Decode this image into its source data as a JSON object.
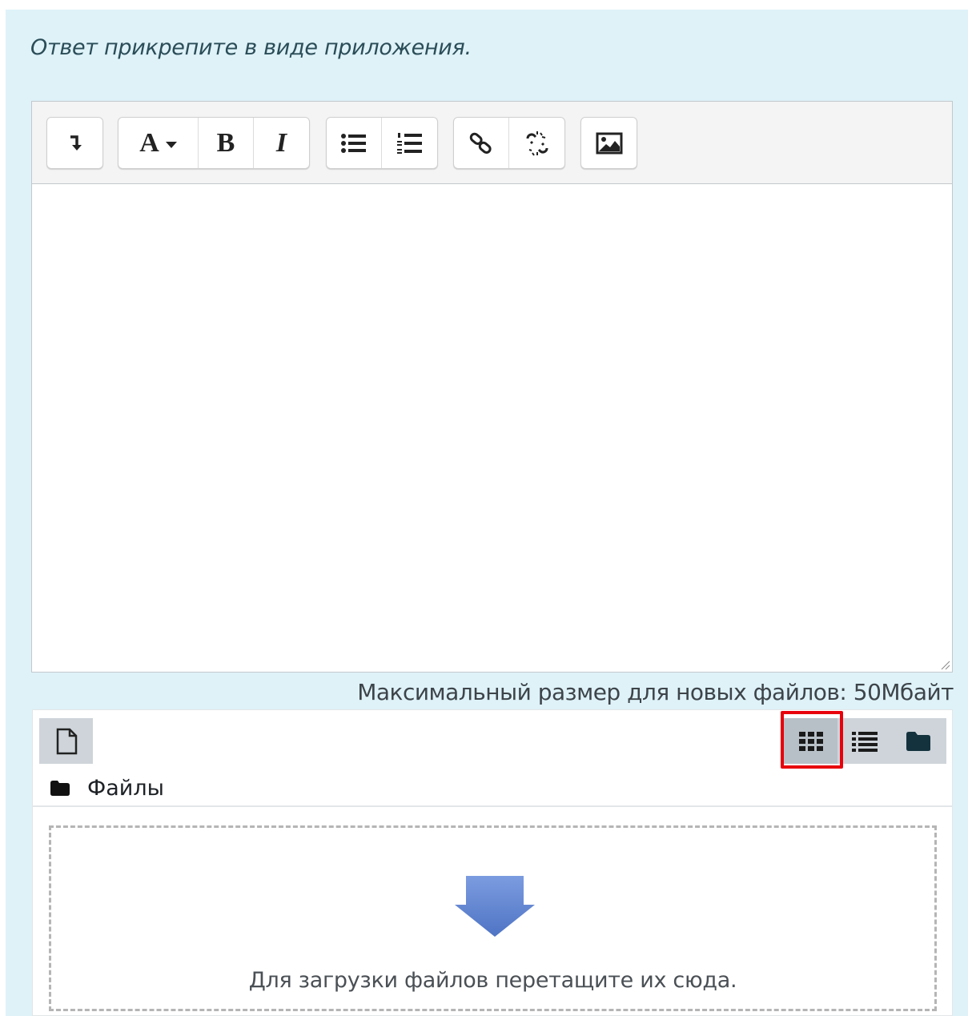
{
  "question": {
    "instruction": "Ответ прикрепите в виде приложения."
  },
  "editor": {
    "toolbar": {
      "groups": [
        [
          "collapse-icon"
        ],
        [
          "font-style-icon",
          "bold-icon",
          "italic-icon"
        ],
        [
          "unordered-list-icon",
          "ordered-list-icon"
        ],
        [
          "link-icon",
          "unlink-icon"
        ],
        [
          "image-icon"
        ]
      ],
      "font_style_label": "A",
      "bold_label": "B",
      "italic_label": "I"
    },
    "content": ""
  },
  "filemanager": {
    "max_size_label": "Максимальный размер для новых файлов: 50Мбайт",
    "path_label": "Файлы",
    "dropzone_text": "Для загрузки файлов перетащите их сюда.",
    "view_modes": [
      "grid-view-icon",
      "list-view-icon",
      "folder-view-icon"
    ],
    "active_view": "grid-view-icon",
    "highlight_color": "#e8000b"
  },
  "colors": {
    "panel_bg": "#def2f8",
    "arrow": "#6b8fd4"
  }
}
